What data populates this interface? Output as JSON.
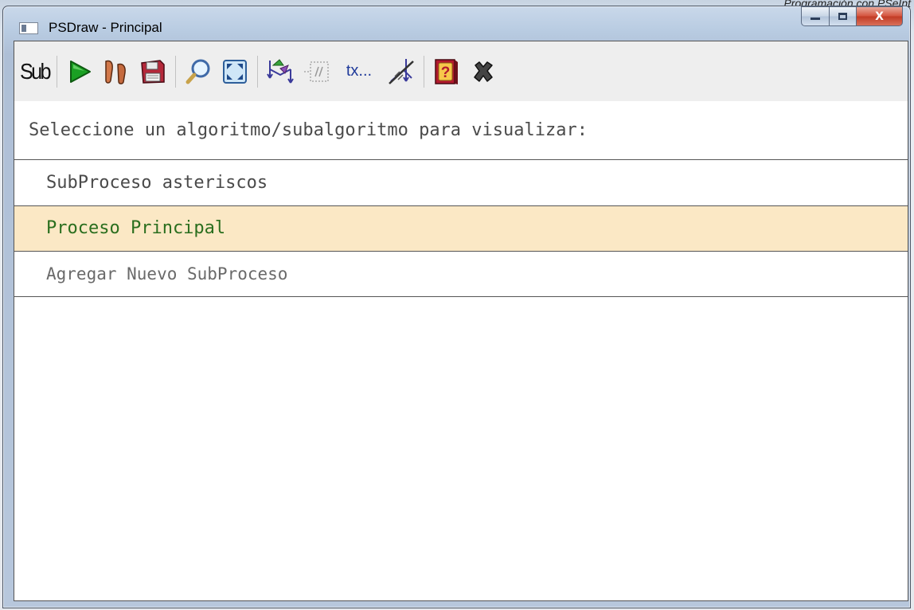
{
  "window": {
    "title": "PSDraw - Principal",
    "top_caption": "Programación con PSeInt",
    "buttons": {
      "close": "X"
    }
  },
  "toolbar": {
    "sub_label": "Sub",
    "tx_label": "tx...",
    "icons": [
      "sub-text",
      "run-icon",
      "step-icon",
      "save-icon",
      "zoom-icon",
      "fit-icon",
      "flowchart-icon",
      "comment-icon",
      "text-icon",
      "delete-shape-icon",
      "help-icon",
      "close-icon"
    ]
  },
  "prompt": {
    "text": "Seleccione un algoritmo/subalgoritmo para visualizar:"
  },
  "list": {
    "items": [
      {
        "label": "SubProceso asteriscos",
        "selected": false
      },
      {
        "label": "Proceso Principal",
        "selected": true
      },
      {
        "label": "Agregar Nuevo SubProceso",
        "selected": false
      }
    ]
  },
  "colors": {
    "selected_bg": "#fbe8c5",
    "selected_text": "#2a6e1e",
    "run_green": "#1aa023",
    "close_red": "#c23b24"
  }
}
